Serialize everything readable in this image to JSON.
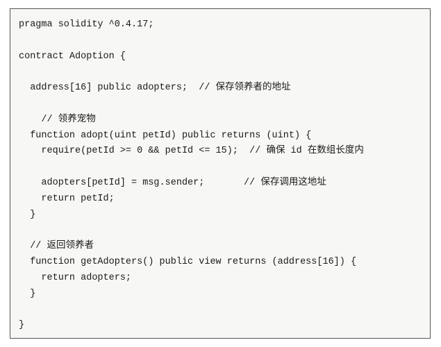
{
  "code_block": {
    "language": "solidity",
    "lines": [
      "pragma solidity ^0.4.17;",
      "",
      "contract Adoption {",
      "",
      "  address[16] public adopters;  // 保存领养者的地址",
      "",
      "    // 领养宠物",
      "  function adopt(uint petId) public returns (uint) {",
      "    require(petId >= 0 && petId <= 15);  // 确保 id 在数组长度内",
      "",
      "    adopters[petId] = msg.sender;       // 保存调用这地址",
      "    return petId;",
      "  }",
      "",
      "  // 返回领养者",
      "  function getAdopters() public view returns (address[16]) {",
      "    return adopters;",
      "  }",
      "",
      "}"
    ]
  },
  "colors": {
    "background": "#f7f7f5",
    "border": "#555555",
    "text": "#1a1a1a"
  }
}
